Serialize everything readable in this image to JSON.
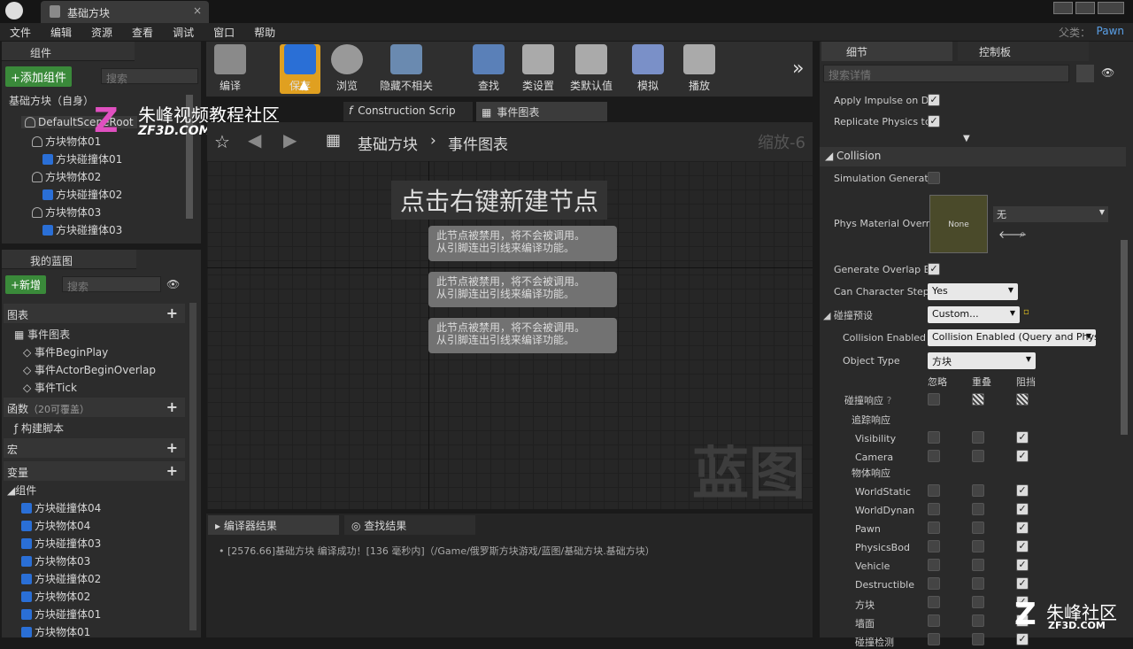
{
  "window": {
    "tab_title": "基础方块",
    "parent_label": "父类：",
    "parent_value": "Pawn"
  },
  "menu": [
    "文件",
    "编辑",
    "资源",
    "查看",
    "调试",
    "窗口",
    "帮助"
  ],
  "components": {
    "title": "组件",
    "add_label": "+添加组件",
    "search_placeholder": "搜索",
    "root_label": "基础方块（自身）",
    "tree": [
      "DefaultSceneRoot",
      "方块物体01",
      "方块碰撞体01",
      "方块物体02",
      "方块碰撞体02",
      "方块物体03",
      "方块碰撞体03"
    ]
  },
  "watermark": {
    "text": "朱峰视频教程社区",
    "sub": "ZF3D.COM"
  },
  "toolbar": [
    {
      "label": "编译"
    },
    {
      "label": "保存"
    },
    {
      "label": "浏览"
    },
    {
      "label": "隐藏不相关"
    },
    {
      "label": "查找"
    },
    {
      "label": "类设置"
    },
    {
      "label": "类默认值"
    },
    {
      "label": "模拟"
    },
    {
      "label": "播放"
    }
  ],
  "editor_tabs": [
    "Construction Scrip",
    "事件图表"
  ],
  "breadcrumb": {
    "root": "基础方块",
    "child": "事件图表",
    "zoom": "缩放-6"
  },
  "graph": {
    "hint": "点击右键新建节点",
    "node_text_1": "此节点被禁用，将不会被调用。",
    "node_text_2": "从引脚连出引线来编译功能。",
    "watermark": "蓝图"
  },
  "my_blueprint": {
    "title": "我的蓝图",
    "new_label": "+新增",
    "search_placeholder": "搜索",
    "graphs_header": "图表",
    "event_graph": "事件图表",
    "events": [
      "事件BeginPlay",
      "事件ActorBeginOverlap",
      "事件Tick"
    ],
    "functions_header": "函数",
    "functions_note": "（20可覆盖）",
    "construction": "构建脚本",
    "macros_header": "宏",
    "variables_header": "变量",
    "components_header": "组件",
    "var_items": [
      "方块碰撞体04",
      "方块物体04",
      "方块碰撞体03",
      "方块物体03",
      "方块碰撞体02",
      "方块物体02",
      "方块碰撞体01",
      "方块物体01"
    ]
  },
  "results": {
    "tab_compiler": "编译器结果",
    "tab_find": "查找结果",
    "log": "[2576.66]基础方块 编译成功！[136 毫秒内]（/Game/俄罗斯方块游戏/蓝图/基础方块.基础方块）"
  },
  "details": {
    "tab_details": "细节",
    "tab_console": "控制板",
    "search_placeholder": "搜索详情",
    "apply_impulse": "Apply Impulse on Da",
    "replicate": "Replicate Physics tc",
    "collision_header": "Collision",
    "sim_generate": "Simulation Generate",
    "phys_material": "Phys Material Overr",
    "none_thumb": "None",
    "material_value": "无",
    "overlap": "Generate Overlap Ev",
    "can_step": "Can Character Step",
    "can_step_value": "Yes",
    "preset_label": "碰撞预设",
    "preset_value": "Custom...",
    "enabled_label": "Collision Enabled",
    "enabled_value": "Collision Enabled (Query and Phys",
    "object_type_label": "Object Type",
    "object_type_value": "方块",
    "col_ignore": "忽略",
    "col_overlap": "重叠",
    "col_block": "阻挡",
    "response_label": "碰撞响应",
    "trace_label": "追踪响应",
    "object_label": "物体响应",
    "channels": [
      "Visibility",
      "Camera",
      "WorldStatic",
      "WorldDynan",
      "Pawn",
      "PhysicsBod",
      "Vehicle",
      "Destructible",
      "方块",
      "墙面",
      "碰撞检测"
    ]
  },
  "brand": {
    "text": "朱峰社区",
    "sub": "ZF3D.COM"
  }
}
